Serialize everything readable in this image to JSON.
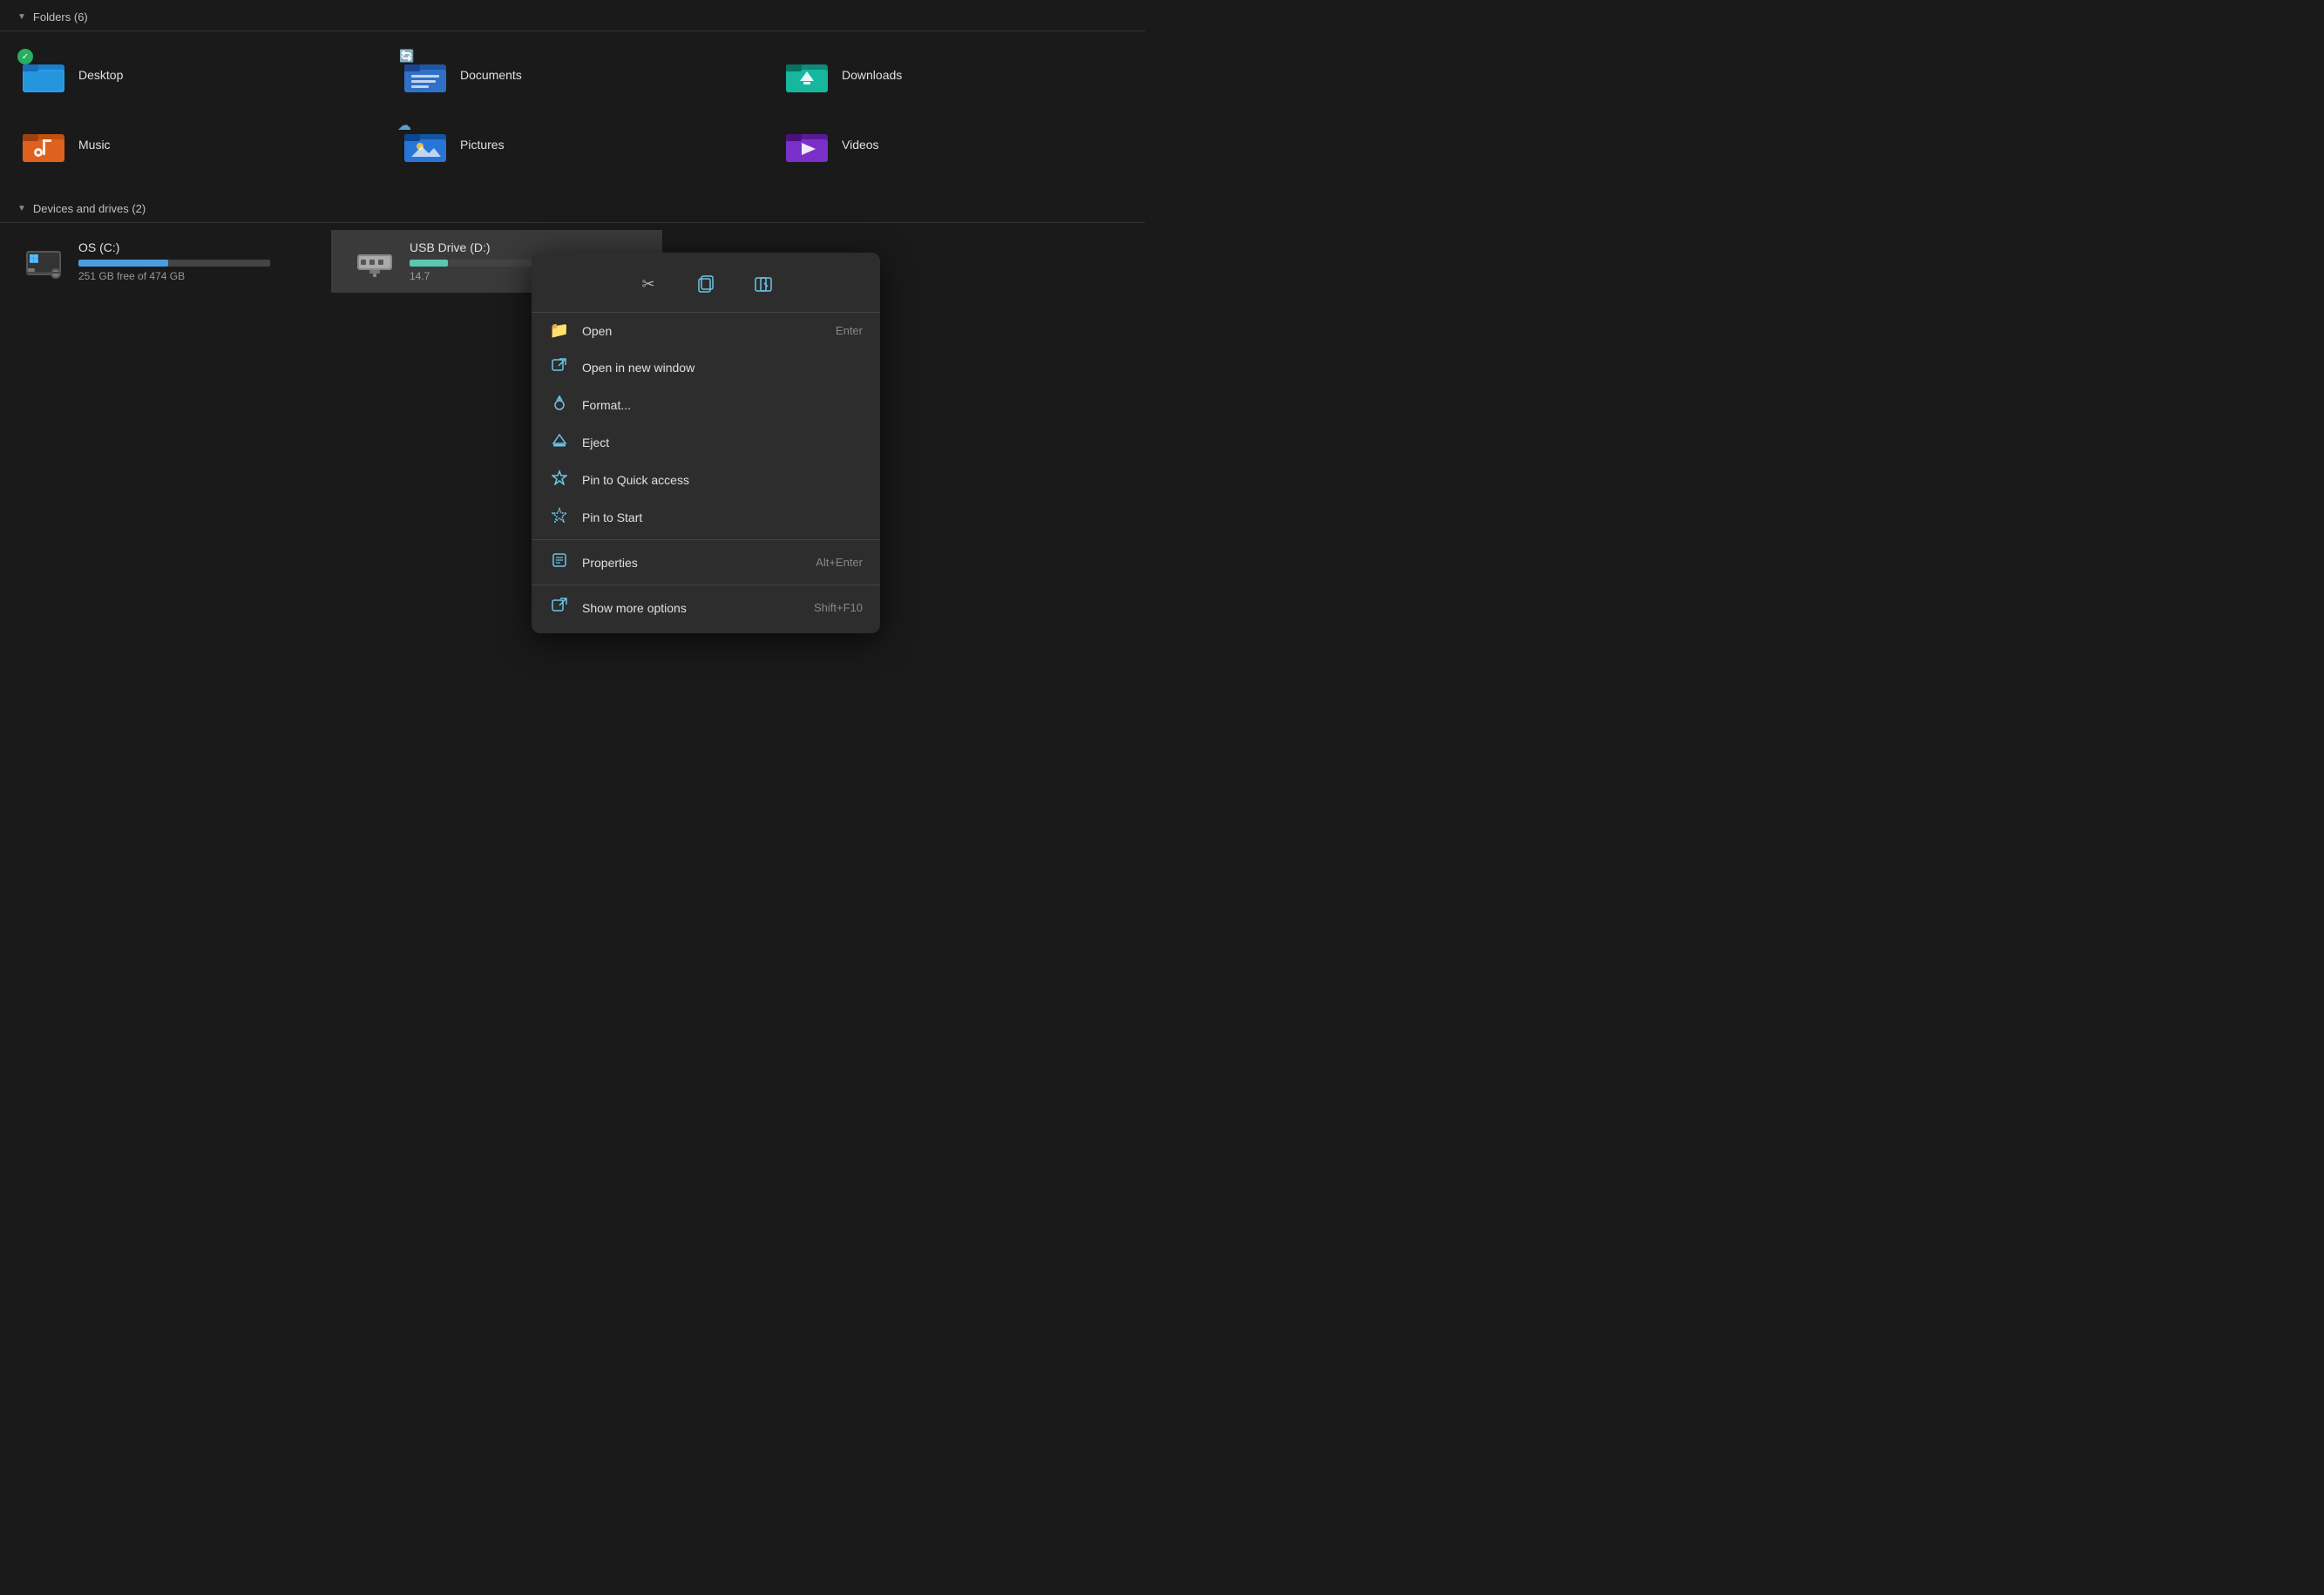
{
  "sections": {
    "folders": {
      "label": "Folders (6)",
      "items": [
        {
          "name": "Desktop",
          "color": "blue",
          "badge": "check"
        },
        {
          "name": "Documents",
          "color": "blue-dark",
          "badge": "sync"
        },
        {
          "name": "Downloads",
          "color": "teal"
        },
        {
          "name": "Music",
          "color": "orange"
        },
        {
          "name": "Pictures",
          "color": "blue-light",
          "badge": "cloud"
        },
        {
          "name": "Videos",
          "color": "purple"
        }
      ]
    },
    "devices": {
      "label": "Devices and drives (2)",
      "items": [
        {
          "name": "OS (C:)",
          "free": "251 GB free of 474 GB",
          "fill_pct": 47,
          "bar_color": "blue"
        },
        {
          "name": "USB Drive (D:)",
          "free": "14.7",
          "fill_pct": 20,
          "bar_color": "teal"
        }
      ]
    }
  },
  "context_menu": {
    "toolbar": [
      {
        "icon": "✂",
        "label": "Cut",
        "name": "cut-button"
      },
      {
        "icon": "⧉",
        "label": "Copy",
        "name": "copy-button"
      },
      {
        "icon": "⊞",
        "label": "Paste shortcut",
        "name": "paste-shortcut-button"
      }
    ],
    "items": [
      {
        "icon": "📁",
        "icon_class": "yellow",
        "label": "Open",
        "shortcut": "Enter",
        "name": "open-item"
      },
      {
        "icon": "↗",
        "icon_class": "",
        "label": "Open in new window",
        "shortcut": "",
        "name": "open-new-window-item"
      },
      {
        "icon": "⊘",
        "icon_class": "",
        "label": "Format...",
        "shortcut": "",
        "name": "format-item"
      },
      {
        "icon": "△",
        "icon_class": "",
        "label": "Eject",
        "shortcut": "",
        "name": "eject-item"
      },
      {
        "icon": "☆",
        "icon_class": "",
        "label": "Pin to Quick access",
        "shortcut": "",
        "name": "pin-quick-access-item"
      },
      {
        "icon": "✦",
        "icon_class": "",
        "label": "Pin to Start",
        "shortcut": "",
        "name": "pin-start-item"
      },
      {
        "divider": true
      },
      {
        "icon": "▦",
        "icon_class": "",
        "label": "Properties",
        "shortcut": "Alt+Enter",
        "name": "properties-item"
      },
      {
        "divider": true
      },
      {
        "icon": "↗",
        "icon_class": "",
        "label": "Show more options",
        "shortcut": "Shift+F10",
        "name": "show-more-options-item"
      }
    ]
  }
}
